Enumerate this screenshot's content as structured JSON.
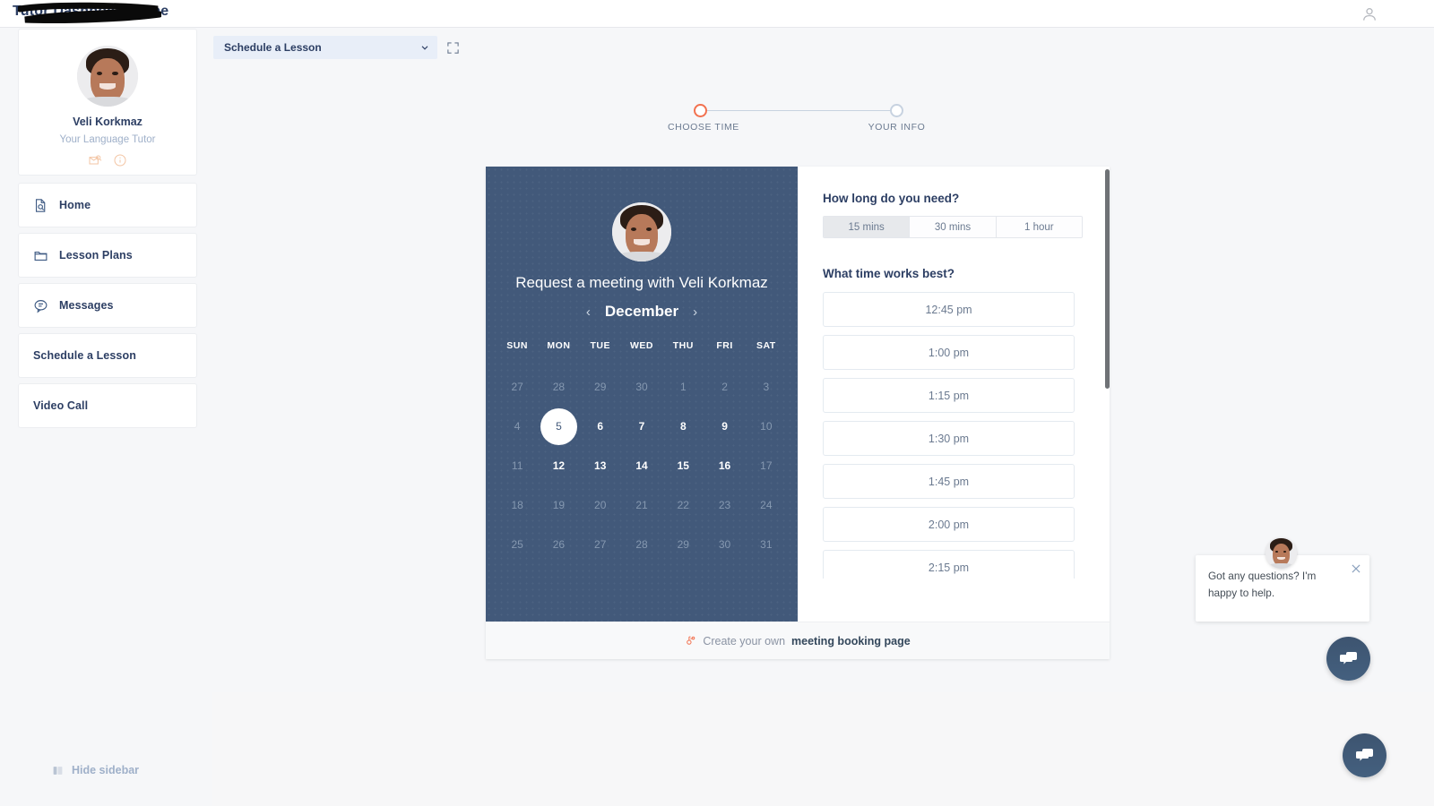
{
  "header": {
    "title": "Tutor Dashboard Pane",
    "title_redacted": true,
    "user_icon": "user-icon"
  },
  "sidebar": {
    "profile": {
      "name": "Veli Korkmaz",
      "role": "Your Language Tutor",
      "icons": [
        "mail-search-icon",
        "info-circle-icon"
      ],
      "accent_color": "#f6c9ab"
    },
    "items": [
      {
        "label": "Home",
        "icon": "document-search-icon"
      },
      {
        "label": "Lesson Plans",
        "icon": "folder-icon"
      },
      {
        "label": "Messages",
        "icon": "chat-bubble-icon"
      },
      {
        "label": "Schedule a Lesson",
        "icon": ""
      },
      {
        "label": "Video Call",
        "icon": ""
      }
    ],
    "hide_sidebar_label": "Hide sidebar",
    "hide_sidebar_icon": "panel-icon"
  },
  "toolbar": {
    "select_value": "Schedule a Lesson",
    "chevron_icon": "chevron-down-icon",
    "expand_icon": "expand-icon"
  },
  "stepper": {
    "steps": [
      {
        "label": "CHOOSE TIME",
        "active": true
      },
      {
        "label": "YOUR INFO",
        "active": false
      }
    ],
    "active_color": "#f2714f",
    "inactive_color": "#c7d2e0"
  },
  "booking": {
    "heading": "Request a meeting with Veli Korkmaz",
    "month": "December",
    "prev_icon": "chevron-left-icon",
    "next_icon": "chevron-right-icon",
    "panel_color": "#42597a",
    "day_headers": [
      "SUN",
      "MON",
      "TUE",
      "WED",
      "THU",
      "FRI",
      "SAT"
    ],
    "weeks": [
      [
        {
          "d": "27",
          "state": "muted"
        },
        {
          "d": "28",
          "state": "muted"
        },
        {
          "d": "29",
          "state": "muted"
        },
        {
          "d": "30",
          "state": "muted"
        },
        {
          "d": "1",
          "state": "muted"
        },
        {
          "d": "2",
          "state": "muted"
        },
        {
          "d": "3",
          "state": "muted"
        }
      ],
      [
        {
          "d": "4",
          "state": "muted"
        },
        {
          "d": "5",
          "state": "selected"
        },
        {
          "d": "6",
          "state": "active"
        },
        {
          "d": "7",
          "state": "active"
        },
        {
          "d": "8",
          "state": "active"
        },
        {
          "d": "9",
          "state": "active"
        },
        {
          "d": "10",
          "state": "muted"
        }
      ],
      [
        {
          "d": "11",
          "state": "muted"
        },
        {
          "d": "12",
          "state": "active"
        },
        {
          "d": "13",
          "state": "active"
        },
        {
          "d": "14",
          "state": "active"
        },
        {
          "d": "15",
          "state": "active"
        },
        {
          "d": "16",
          "state": "active"
        },
        {
          "d": "17",
          "state": "muted"
        }
      ],
      [
        {
          "d": "18",
          "state": "muted"
        },
        {
          "d": "19",
          "state": "muted"
        },
        {
          "d": "20",
          "state": "muted"
        },
        {
          "d": "21",
          "state": "muted"
        },
        {
          "d": "22",
          "state": "muted"
        },
        {
          "d": "23",
          "state": "muted"
        },
        {
          "d": "24",
          "state": "muted"
        }
      ],
      [
        {
          "d": "25",
          "state": "muted"
        },
        {
          "d": "26",
          "state": "muted"
        },
        {
          "d": "27",
          "state": "muted"
        },
        {
          "d": "28",
          "state": "muted"
        },
        {
          "d": "29",
          "state": "muted"
        },
        {
          "d": "30",
          "state": "muted"
        },
        {
          "d": "31",
          "state": "muted"
        }
      ]
    ],
    "duration_question": "How long do you need?",
    "durations": [
      {
        "label": "15 mins",
        "selected": true
      },
      {
        "label": "30 mins",
        "selected": false
      },
      {
        "label": "1 hour",
        "selected": false
      }
    ],
    "time_question": "What time works best?",
    "times": [
      "12:45 pm",
      "1:00 pm",
      "1:15 pm",
      "1:30 pm",
      "1:45 pm",
      "2:00 pm",
      "2:15 pm"
    ],
    "footer": {
      "icon": "sprocket-icon",
      "text": "Create your own",
      "link": "meeting booking page"
    }
  },
  "chat": {
    "message": "Got any questions? I'm happy to help.",
    "close_icon": "close-icon",
    "fab_icon": "chat-bubbles-icon",
    "avatar": "tutor-avatar"
  }
}
